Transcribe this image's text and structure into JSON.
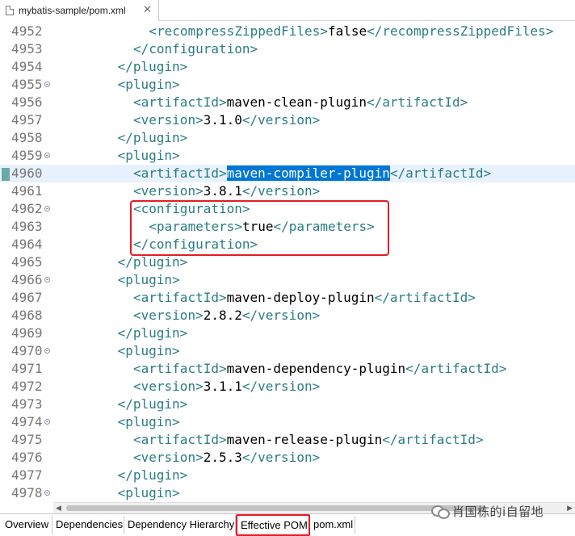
{
  "editor_tab": {
    "title": "mybatis-sample/pom.xml",
    "close_glyph": "✕"
  },
  "code_lines": [
    {
      "n": "4952",
      "indent": 6,
      "parts": [
        [
          "b",
          "<"
        ],
        [
          "t",
          "recompressZippedFiles"
        ],
        [
          "b",
          ">"
        ],
        [
          "x",
          "false"
        ],
        [
          "b",
          "</"
        ],
        [
          "t",
          "recompressZippedFiles"
        ],
        [
          "b",
          ">"
        ]
      ]
    },
    {
      "n": "4953",
      "indent": 5,
      "parts": [
        [
          "b",
          "</"
        ],
        [
          "t",
          "configuration"
        ],
        [
          "b",
          ">"
        ]
      ]
    },
    {
      "n": "4954",
      "indent": 4,
      "parts": [
        [
          "b",
          "</"
        ],
        [
          "t",
          "plugin"
        ],
        [
          "b",
          ">"
        ]
      ]
    },
    {
      "n": "4955",
      "indent": 4,
      "fold": true,
      "parts": [
        [
          "b",
          "<"
        ],
        [
          "t",
          "plugin"
        ],
        [
          "b",
          ">"
        ]
      ]
    },
    {
      "n": "4956",
      "indent": 5,
      "parts": [
        [
          "b",
          "<"
        ],
        [
          "t",
          "artifactId"
        ],
        [
          "b",
          ">"
        ],
        [
          "x",
          "maven-clean-plugin"
        ],
        [
          "b",
          "</"
        ],
        [
          "t",
          "artifactId"
        ],
        [
          "b",
          ">"
        ]
      ]
    },
    {
      "n": "4957",
      "indent": 5,
      "parts": [
        [
          "b",
          "<"
        ],
        [
          "t",
          "version"
        ],
        [
          "b",
          ">"
        ],
        [
          "x",
          "3.1.0"
        ],
        [
          "b",
          "</"
        ],
        [
          "t",
          "version"
        ],
        [
          "b",
          ">"
        ]
      ]
    },
    {
      "n": "4958",
      "indent": 4,
      "parts": [
        [
          "b",
          "</"
        ],
        [
          "t",
          "plugin"
        ],
        [
          "b",
          ">"
        ]
      ]
    },
    {
      "n": "4959",
      "indent": 4,
      "fold": true,
      "parts": [
        [
          "b",
          "<"
        ],
        [
          "t",
          "plugin"
        ],
        [
          "b",
          ">"
        ]
      ]
    },
    {
      "n": "4960",
      "indent": 5,
      "current": true,
      "parts": [
        [
          "b",
          "<"
        ],
        [
          "t",
          "artifactId"
        ],
        [
          "b",
          ">"
        ],
        [
          "s",
          "maven-compiler-plugin"
        ],
        [
          "b",
          "</"
        ],
        [
          "t",
          "artifactId"
        ],
        [
          "b",
          ">"
        ]
      ]
    },
    {
      "n": "4961",
      "indent": 5,
      "parts": [
        [
          "b",
          "<"
        ],
        [
          "t",
          "version"
        ],
        [
          "b",
          ">"
        ],
        [
          "x",
          "3.8.1"
        ],
        [
          "b",
          "</"
        ],
        [
          "t",
          "version"
        ],
        [
          "b",
          ">"
        ]
      ]
    },
    {
      "n": "4962",
      "indent": 5,
      "fold": true,
      "parts": [
        [
          "b",
          "<"
        ],
        [
          "t",
          "configuration"
        ],
        [
          "b",
          ">"
        ]
      ]
    },
    {
      "n": "4963",
      "indent": 6,
      "parts": [
        [
          "b",
          "<"
        ],
        [
          "t",
          "parameters"
        ],
        [
          "b",
          ">"
        ],
        [
          "x",
          "true"
        ],
        [
          "b",
          "</"
        ],
        [
          "t",
          "parameters"
        ],
        [
          "b",
          ">"
        ]
      ]
    },
    {
      "n": "4964",
      "indent": 5,
      "parts": [
        [
          "b",
          "</"
        ],
        [
          "t",
          "configuration"
        ],
        [
          "b",
          ">"
        ]
      ]
    },
    {
      "n": "4965",
      "indent": 4,
      "parts": [
        [
          "b",
          "</"
        ],
        [
          "t",
          "plugin"
        ],
        [
          "b",
          ">"
        ]
      ]
    },
    {
      "n": "4966",
      "indent": 4,
      "fold": true,
      "parts": [
        [
          "b",
          "<"
        ],
        [
          "t",
          "plugin"
        ],
        [
          "b",
          ">"
        ]
      ]
    },
    {
      "n": "4967",
      "indent": 5,
      "parts": [
        [
          "b",
          "<"
        ],
        [
          "t",
          "artifactId"
        ],
        [
          "b",
          ">"
        ],
        [
          "x",
          "maven-deploy-plugin"
        ],
        [
          "b",
          "</"
        ],
        [
          "t",
          "artifactId"
        ],
        [
          "b",
          ">"
        ]
      ]
    },
    {
      "n": "4968",
      "indent": 5,
      "parts": [
        [
          "b",
          "<"
        ],
        [
          "t",
          "version"
        ],
        [
          "b",
          ">"
        ],
        [
          "x",
          "2.8.2"
        ],
        [
          "b",
          "</"
        ],
        [
          "t",
          "version"
        ],
        [
          "b",
          ">"
        ]
      ]
    },
    {
      "n": "4969",
      "indent": 4,
      "parts": [
        [
          "b",
          "</"
        ],
        [
          "t",
          "plugin"
        ],
        [
          "b",
          ">"
        ]
      ]
    },
    {
      "n": "4970",
      "indent": 4,
      "fold": true,
      "parts": [
        [
          "b",
          "<"
        ],
        [
          "t",
          "plugin"
        ],
        [
          "b",
          ">"
        ]
      ]
    },
    {
      "n": "4971",
      "indent": 5,
      "parts": [
        [
          "b",
          "<"
        ],
        [
          "t",
          "artifactId"
        ],
        [
          "b",
          ">"
        ],
        [
          "x",
          "maven-dependency-plugin"
        ],
        [
          "b",
          "</"
        ],
        [
          "t",
          "artifactId"
        ],
        [
          "b",
          ">"
        ]
      ]
    },
    {
      "n": "4972",
      "indent": 5,
      "parts": [
        [
          "b",
          "<"
        ],
        [
          "t",
          "version"
        ],
        [
          "b",
          ">"
        ],
        [
          "x",
          "3.1.1"
        ],
        [
          "b",
          "</"
        ],
        [
          "t",
          "version"
        ],
        [
          "b",
          ">"
        ]
      ]
    },
    {
      "n": "4973",
      "indent": 4,
      "parts": [
        [
          "b",
          "</"
        ],
        [
          "t",
          "plugin"
        ],
        [
          "b",
          ">"
        ]
      ]
    },
    {
      "n": "4974",
      "indent": 4,
      "fold": true,
      "parts": [
        [
          "b",
          "<"
        ],
        [
          "t",
          "plugin"
        ],
        [
          "b",
          ">"
        ]
      ]
    },
    {
      "n": "4975",
      "indent": 5,
      "parts": [
        [
          "b",
          "<"
        ],
        [
          "t",
          "artifactId"
        ],
        [
          "b",
          ">"
        ],
        [
          "x",
          "maven-release-plugin"
        ],
        [
          "b",
          "</"
        ],
        [
          "t",
          "artifactId"
        ],
        [
          "b",
          ">"
        ]
      ]
    },
    {
      "n": "4976",
      "indent": 5,
      "parts": [
        [
          "b",
          "<"
        ],
        [
          "t",
          "version"
        ],
        [
          "b",
          ">"
        ],
        [
          "x",
          "2.5.3"
        ],
        [
          "b",
          "</"
        ],
        [
          "t",
          "version"
        ],
        [
          "b",
          ">"
        ]
      ]
    },
    {
      "n": "4977",
      "indent": 4,
      "parts": [
        [
          "b",
          "</"
        ],
        [
          "t",
          "plugin"
        ],
        [
          "b",
          ">"
        ]
      ]
    },
    {
      "n": "4978",
      "indent": 4,
      "fold": true,
      "parts": [
        [
          "b",
          "<"
        ],
        [
          "t",
          "plugin"
        ],
        [
          "b",
          ">"
        ]
      ]
    }
  ],
  "page_tabs": [
    {
      "label": "Overview",
      "active": false
    },
    {
      "label": "Dependencies",
      "active": false
    },
    {
      "label": "Dependency Hierarchy",
      "active": false
    },
    {
      "label": "Effective POM",
      "active": true
    },
    {
      "label": "pom.xml",
      "active": false
    }
  ],
  "watermark": {
    "text": "肖国栋的i自留地"
  },
  "colors": {
    "tag": "#2a7d84",
    "selection": "#0077d4",
    "highlight_box": "#e51b24",
    "current_line": "#e8f2fe"
  }
}
